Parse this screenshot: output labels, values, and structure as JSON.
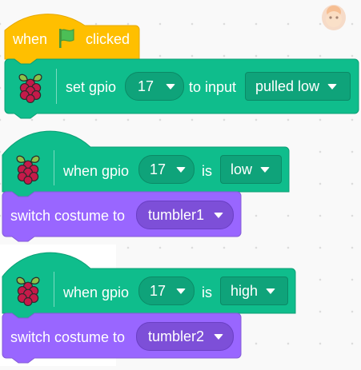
{
  "colors": {
    "event": "#FFBF00",
    "extension": "#0FBD8C",
    "looks": "#9966FF",
    "canvas": "#F9F9F9"
  },
  "stack1": {
    "hat": {
      "when": "when",
      "clicked": "clicked",
      "icon": "green-flag-icon"
    },
    "set_gpio": {
      "prefix": "set gpio",
      "pin": "17",
      "middle": "to input",
      "mode": "pulled low",
      "icon": "raspberry-pi-icon"
    }
  },
  "stack2": {
    "hat": {
      "prefix": "when gpio",
      "pin": "17",
      "middle": "is",
      "state": "low",
      "icon": "raspberry-pi-icon"
    },
    "costume": {
      "prefix": "switch costume to",
      "value": "tumbler1"
    }
  },
  "stack3": {
    "hat": {
      "prefix": "when gpio",
      "pin": "17",
      "middle": "is",
      "state": "high",
      "icon": "raspberry-pi-icon"
    },
    "costume": {
      "prefix": "switch costume to",
      "value": "tumbler2"
    }
  },
  "sprite_icon": "sprite-avatar-icon"
}
